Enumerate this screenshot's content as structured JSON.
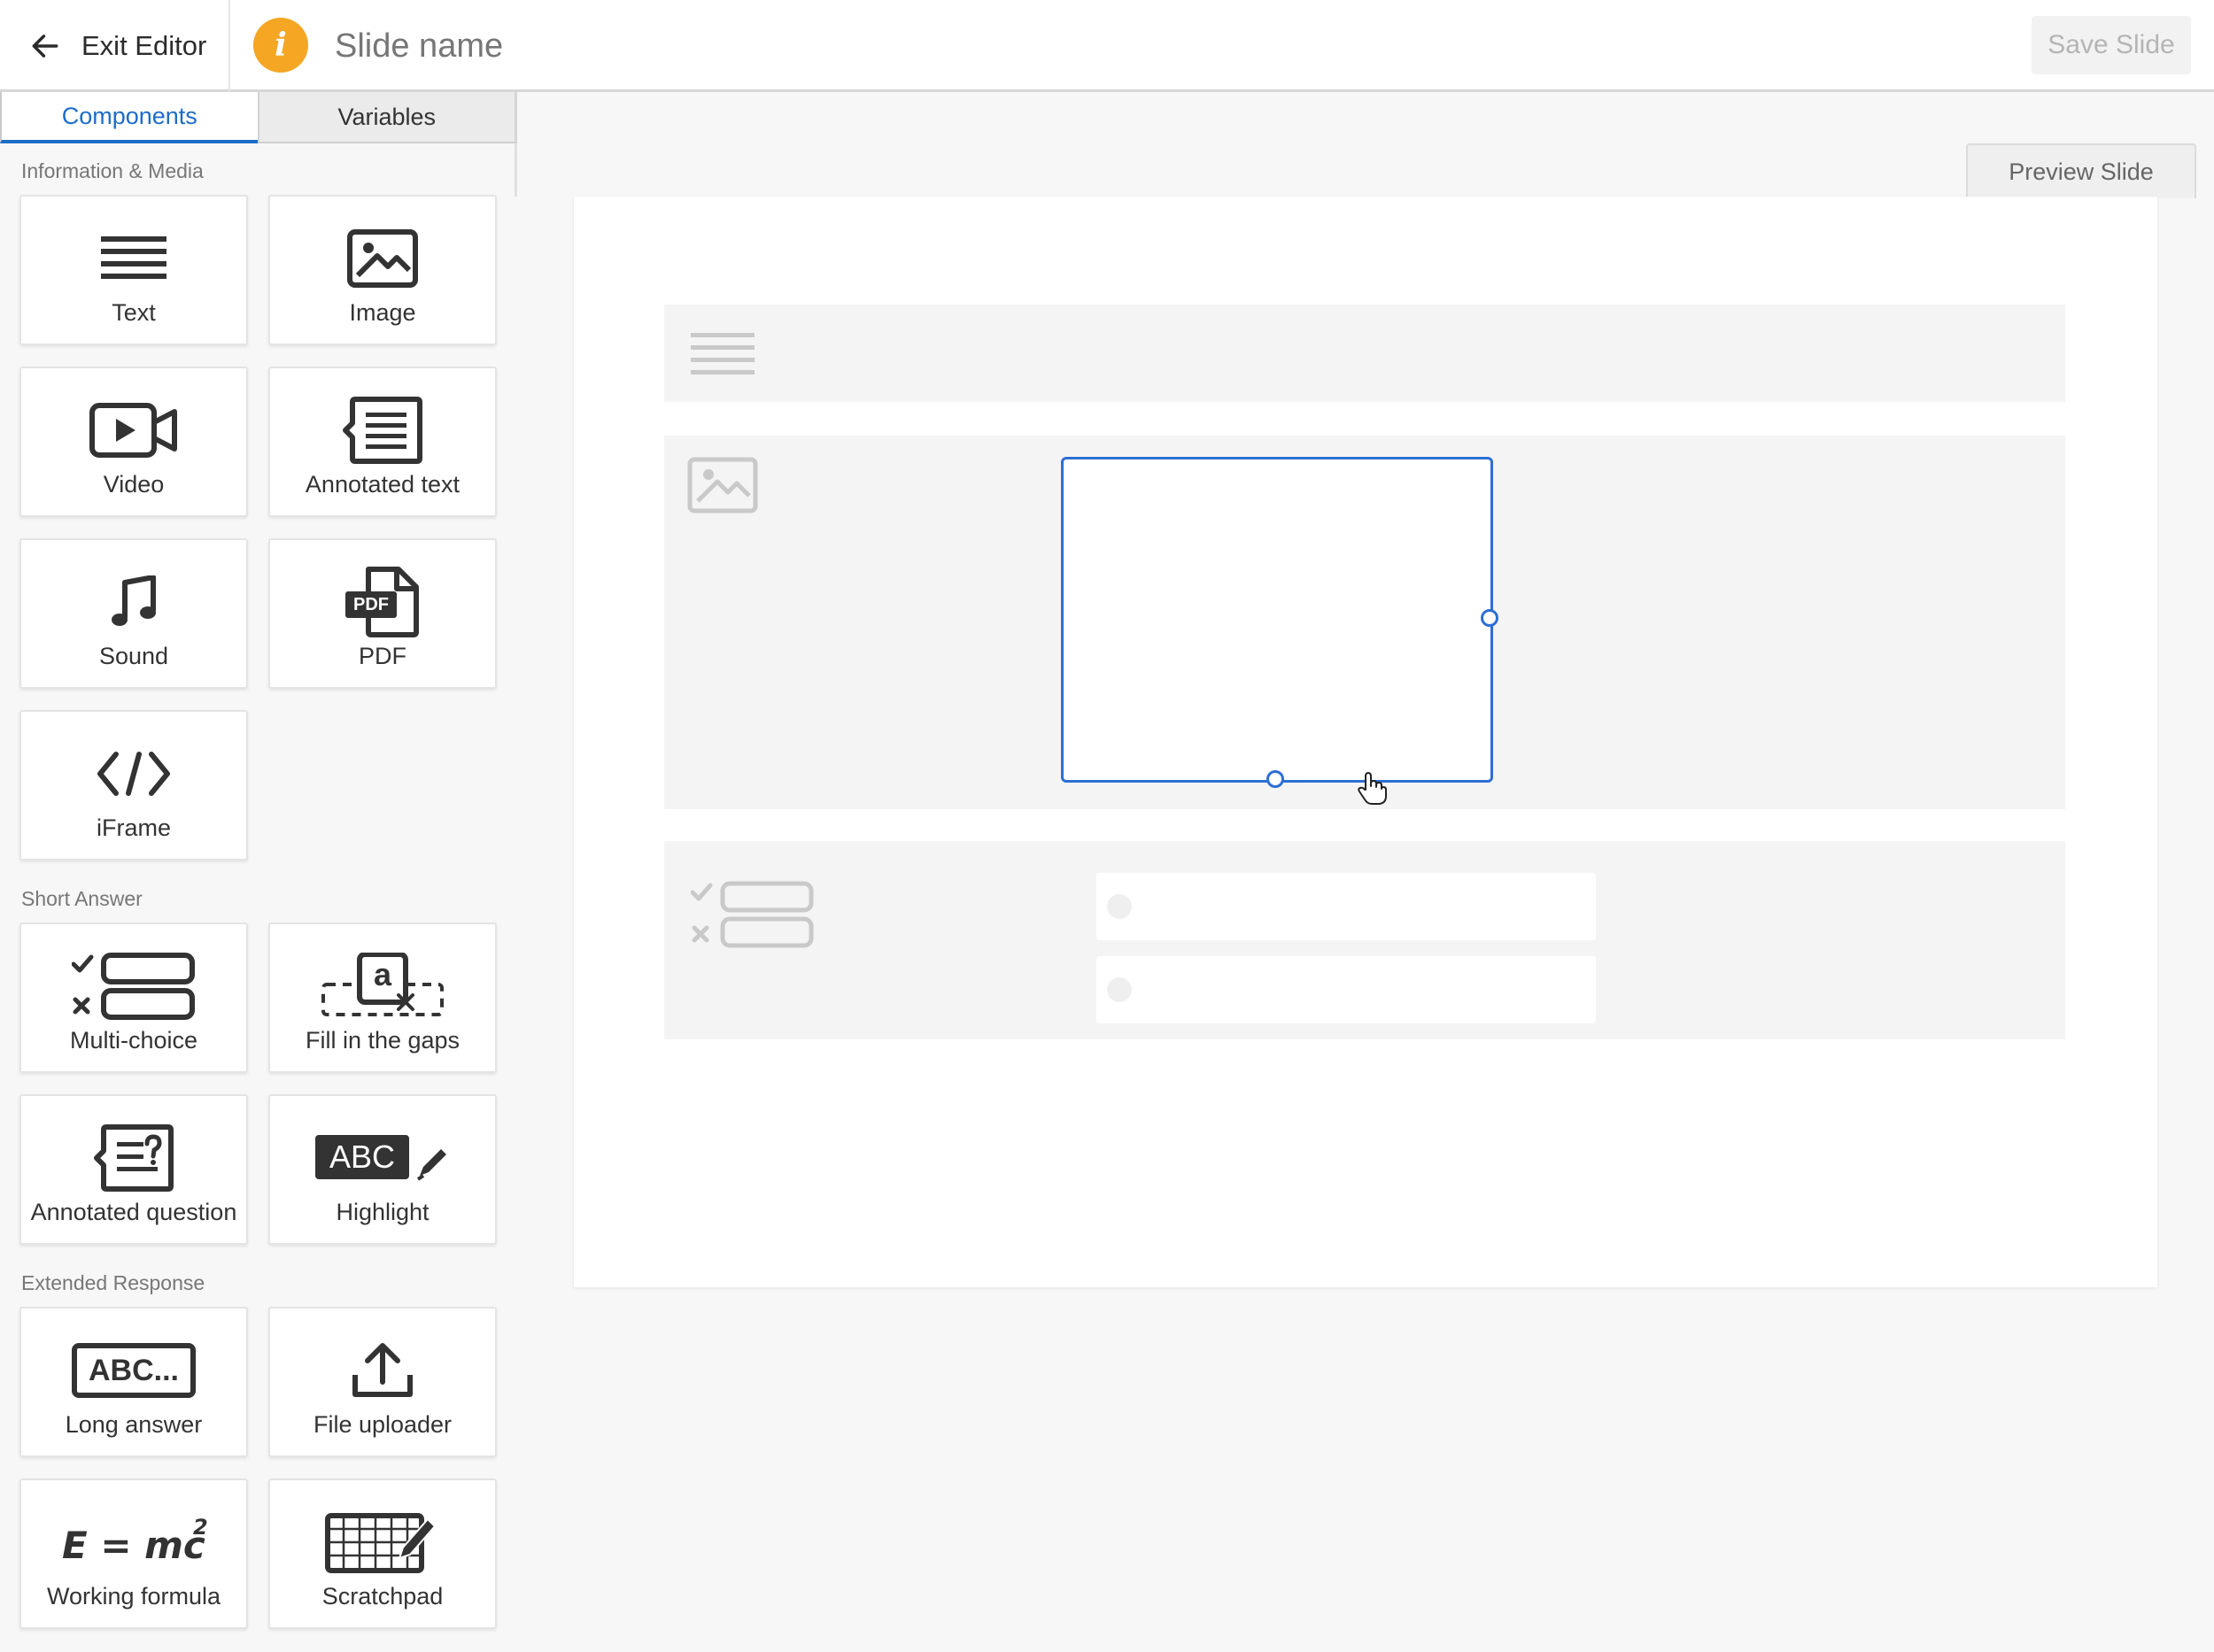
{
  "header": {
    "exit_label": "Exit Editor",
    "info_glyph": "i",
    "slide_name": "Slide name",
    "save_label": "Save Slide",
    "accent_color": "#f5a623"
  },
  "sidebar": {
    "tabs": [
      {
        "label": "Components",
        "active": true
      },
      {
        "label": "Variables",
        "active": false
      }
    ],
    "sections": [
      {
        "label": "Information & Media",
        "items": [
          {
            "label": "Text",
            "icon": "text-lines-icon"
          },
          {
            "label": "Image",
            "icon": "image-icon"
          },
          {
            "label": "Video",
            "icon": "video-camera-icon"
          },
          {
            "label": "Annotated text",
            "icon": "annotated-text-icon"
          },
          {
            "label": "Sound",
            "icon": "music-note-icon"
          },
          {
            "label": "PDF",
            "icon": "pdf-file-icon"
          },
          {
            "label": "iFrame",
            "icon": "code-brackets-icon"
          }
        ]
      },
      {
        "label": "Short Answer",
        "items": [
          {
            "label": "Multi-choice",
            "icon": "multi-choice-icon"
          },
          {
            "label": "Fill in the gaps",
            "icon": "fill-gaps-icon"
          },
          {
            "label": "Annotated question",
            "icon": "annotated-question-icon"
          },
          {
            "label": "Highlight",
            "icon": "highlight-icon"
          }
        ]
      },
      {
        "label": "Extended Response",
        "items": [
          {
            "label": "Long answer",
            "icon": "long-answer-icon"
          },
          {
            "label": "File uploader",
            "icon": "upload-icon"
          },
          {
            "label": "Working formula",
            "icon": "formula-icon"
          },
          {
            "label": "Scratchpad",
            "icon": "scratchpad-icon"
          }
        ]
      }
    ]
  },
  "icon_text": {
    "pdf": "PDF",
    "gap_letter": "a",
    "highlight_text": "ABC",
    "long_answer_text": "ABC...",
    "formula_text": "E = mc",
    "formula_exp": "2"
  },
  "canvas": {
    "preview_label": "Preview Slide",
    "selection_color": "#2d6fd3"
  }
}
